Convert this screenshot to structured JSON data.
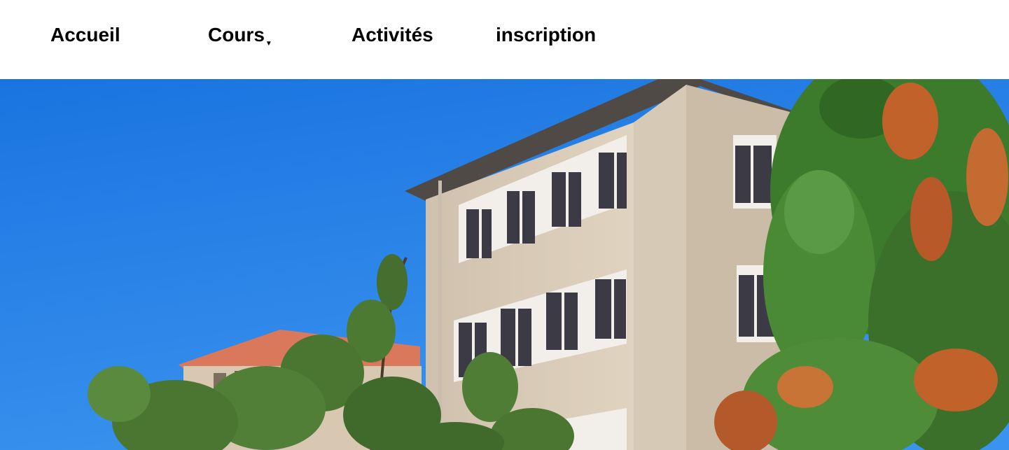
{
  "nav": {
    "items": [
      {
        "label": "Accueil"
      },
      {
        "label": "Cours",
        "has_dropdown": true,
        "caret_icon": "caret-down-icon"
      },
      {
        "label": "Activités"
      },
      {
        "label": "inscription"
      }
    ]
  },
  "hero": {
    "image": "school-building-photo",
    "colors": {
      "sky": "#1f7fe6",
      "facade": "#d9cbb8",
      "roof": "#d9785a",
      "foliage": "#3f7a2e",
      "autumn": "#c0622a"
    }
  }
}
